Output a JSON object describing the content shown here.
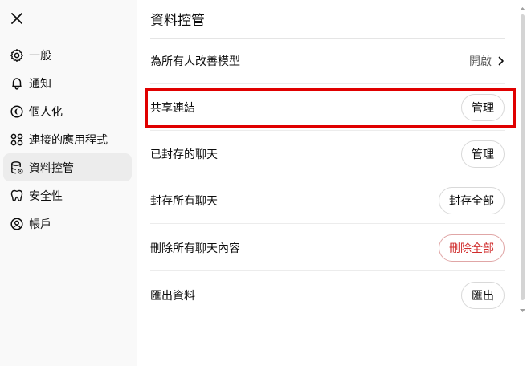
{
  "sidebar": {
    "items": [
      {
        "label": "一般",
        "icon": "gear-icon"
      },
      {
        "label": "通知",
        "icon": "bell-icon"
      },
      {
        "label": "個人化",
        "icon": "personalization-icon"
      },
      {
        "label": "連接的應用程式",
        "icon": "apps-icon"
      },
      {
        "label": "資料控管",
        "icon": "database-icon",
        "active": true
      },
      {
        "label": "安全性",
        "icon": "shield-icon"
      },
      {
        "label": "帳戶",
        "icon": "account-icon"
      }
    ]
  },
  "main": {
    "title": "資料控管",
    "rows": [
      {
        "label": "為所有人改善模型",
        "value": "開啟"
      },
      {
        "label": "共享連結",
        "button": "管理"
      },
      {
        "label": "已封存的聊天",
        "button": "管理"
      },
      {
        "label": "封存所有聊天",
        "button": "封存全部"
      },
      {
        "label": "刪除所有聊天內容",
        "button": "刪除全部"
      },
      {
        "label": "匯出資料",
        "button": "匯出"
      }
    ]
  },
  "colors": {
    "danger": "#d02c2c",
    "highlight": "#e00000",
    "sidebar_bg": "#f9f9f9",
    "active_bg": "#ececec"
  }
}
